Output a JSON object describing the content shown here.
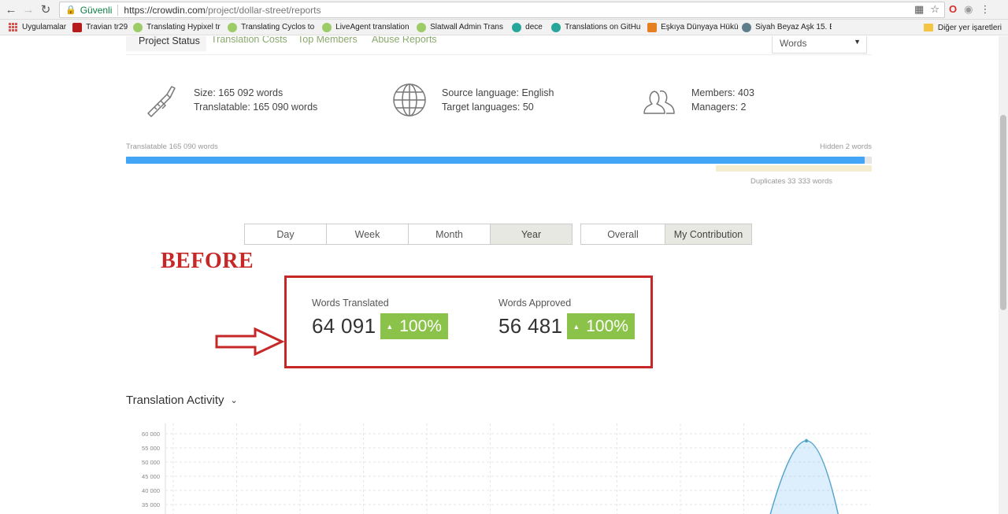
{
  "browser": {
    "secure_label": "Güvenli",
    "url_host": "https://crowdin.com",
    "url_path": "/project/dollar-street/reports",
    "bookmarks": [
      {
        "label": "Uygulamalar",
        "color": "#d9534f"
      },
      {
        "label": "Travian tr29",
        "color": "#b71c1c"
      },
      {
        "label": "Translating Hypixel tr",
        "color": "#9ccc65"
      },
      {
        "label": "Translating Cyclos to",
        "color": "#9ccc65"
      },
      {
        "label": "LiveAgent translation",
        "color": "#9ccc65"
      },
      {
        "label": "Slatwall Admin Trans",
        "color": "#9ccc65"
      },
      {
        "label": "dece",
        "color": "#26a69a"
      },
      {
        "label": "Translations on GitHu",
        "color": "#26a69a"
      },
      {
        "label": "Eşkıya Dünyaya Hükü",
        "color": "#e67e22"
      },
      {
        "label": "Siyah Beyaz Aşk 15. B",
        "color": "#607d8b"
      }
    ],
    "other_bookmarks": "Diğer yer işaretleri"
  },
  "tabs": [
    {
      "label": "Project Status",
      "active": true
    },
    {
      "label": "Translation Costs",
      "active": false
    },
    {
      "label": "Top Members",
      "active": false
    },
    {
      "label": "Abuse Reports",
      "active": false
    }
  ],
  "unit_select": "Words",
  "stats": {
    "size": "Size: 165 092 words",
    "translatable": "Translatable: 165 090 words",
    "source_language": "Source language: English",
    "target_languages": "Target languages: 50",
    "members": "Members: 403",
    "managers": "Managers: 2"
  },
  "progress": {
    "left_label": "Translatable 165 090 words",
    "right_label": "Hidden 2 words",
    "duplicates_label": "Duplicates 33 333 words",
    "translatable_fraction": 0.99
  },
  "periods": [
    {
      "label": "Day",
      "active": false
    },
    {
      "label": "Week",
      "active": false
    },
    {
      "label": "Month",
      "active": false
    },
    {
      "label": "Year",
      "active": true
    }
  ],
  "scopes": [
    {
      "label": "Overall",
      "active": false
    },
    {
      "label": "My Contribution",
      "active": true
    }
  ],
  "annotation": "BEFORE",
  "metrics": {
    "translated": {
      "label": "Words Translated",
      "value": "64 091",
      "change": "100%"
    },
    "approved": {
      "label": "Words Approved",
      "value": "56 481",
      "change": "100%"
    }
  },
  "activity_title": "Translation Activity",
  "colors": {
    "accent_green": "#8bc34a",
    "progress_blue": "#42a5f5",
    "annotation_red": "#c62828",
    "tab_green": "#8aa96c"
  },
  "chart_data": {
    "type": "area",
    "y_ticks": [
      "60 000",
      "55 000",
      "50 000",
      "45 000",
      "40 000",
      "35 000"
    ],
    "ylim": [
      35000,
      60000
    ],
    "visible_peak": 57500
  }
}
